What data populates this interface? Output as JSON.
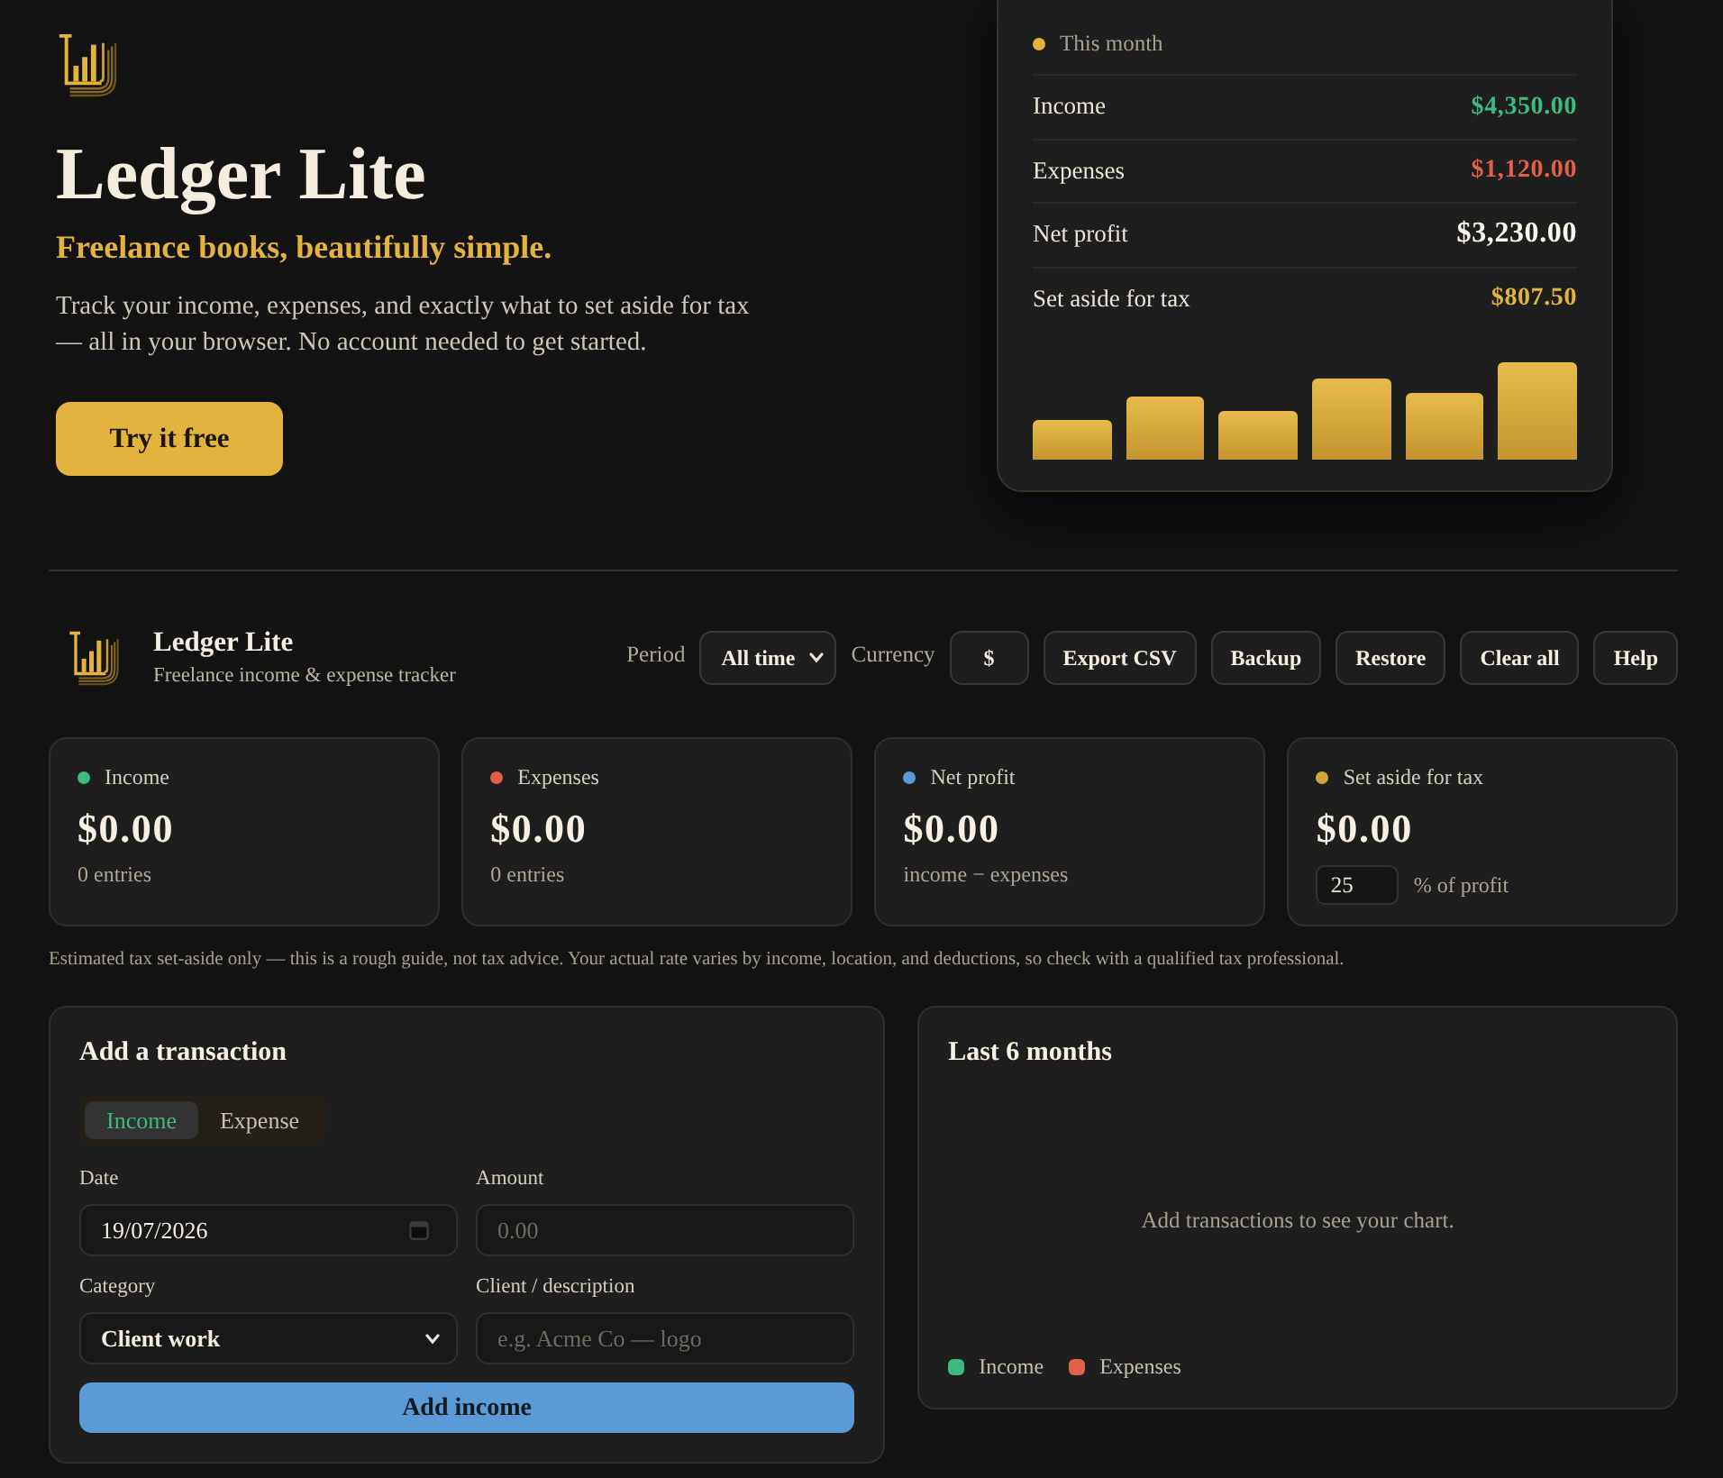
{
  "hero": {
    "title": "Ledger Lite",
    "tagline": "Freelance books, beautifully simple.",
    "description": "Track your income, expenses, and exactly what to set aside for tax — all in your browser. No account needed to get started.",
    "cta": "Try it free"
  },
  "preview": {
    "label": "This month",
    "rows": [
      {
        "label": "Income",
        "value": "$4,350.00",
        "kind": "income"
      },
      {
        "label": "Expenses",
        "value": "$1,120.00",
        "kind": "expense"
      },
      {
        "label": "Net profit",
        "value": "$3,230.00",
        "kind": "profit"
      },
      {
        "label": "Set aside for tax",
        "value": "$807.50",
        "kind": "tax"
      }
    ]
  },
  "app_header": {
    "name": "Ledger Lite",
    "subtitle": "Freelance income & expense tracker",
    "period": {
      "label": "Period",
      "value": "All time"
    },
    "currency": {
      "label": "Currency",
      "value": "$"
    },
    "buttons": [
      "Export CSV",
      "Backup",
      "Restore",
      "Clear all",
      "Help"
    ]
  },
  "stats": [
    {
      "label": "Income",
      "color": "#3dba7e",
      "value": "$0.00",
      "kind": "note",
      "note": "0 entries"
    },
    {
      "label": "Expenses",
      "color": "#e0604a",
      "value": "$0.00",
      "kind": "note",
      "note": "0 entries"
    },
    {
      "label": "Net profit",
      "color": "#5a9ad6",
      "value": "$0.00",
      "kind": "note",
      "note": "income − expenses"
    },
    {
      "label": "Set aside for tax",
      "color": "#d4a43a",
      "value": "$0.00",
      "kind": "rate",
      "rate": "25",
      "note": "% of profit"
    }
  ],
  "disclaimer": "Estimated tax set-aside only — this is a rough guide, not tax advice. Your actual rate varies by income, location, and deductions, so check with a qualified tax professional.",
  "transaction_form": {
    "title": "Add a transaction",
    "type_tabs": [
      {
        "label": "Income",
        "selected": true
      },
      {
        "label": "Expense",
        "selected": false
      }
    ],
    "fields": [
      {
        "label": "Date",
        "kind": "date",
        "value": "19/07/2026"
      },
      {
        "label": "Amount",
        "kind": "text",
        "placeholder": "0.00"
      },
      {
        "label": "Category",
        "kind": "select",
        "value": "Client work"
      },
      {
        "label": "Client / description",
        "kind": "text",
        "placeholder": "e.g. Acme Co — logo"
      }
    ],
    "submit": "Add income"
  },
  "chart_panel": {
    "title": "Last 6 months",
    "empty_message": "Add transactions to see your chart.",
    "legend": [
      {
        "label": "Income",
        "color": "#3dba7e"
      },
      {
        "label": "Expenses",
        "color": "#e0604a"
      }
    ]
  }
}
